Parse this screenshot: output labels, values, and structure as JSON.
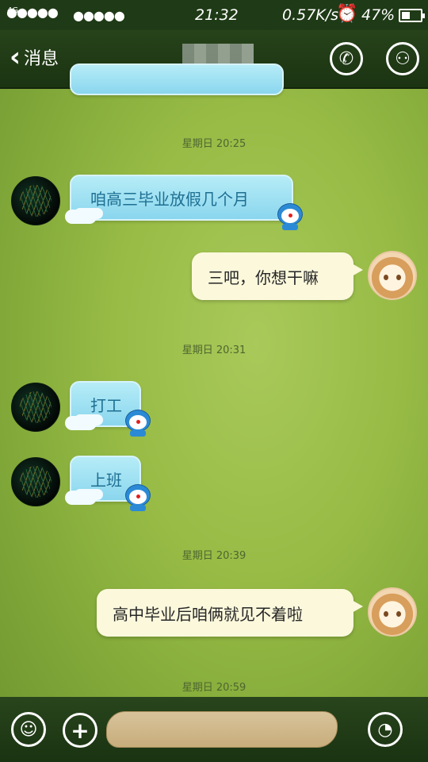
{
  "status_bar": {
    "network": "4G",
    "time": "21:32",
    "speed": "0.57K/s",
    "battery_text": "47%",
    "battery_level": 0.47
  },
  "header": {
    "back_label": "消息",
    "contact_name": ""
  },
  "messages": [
    {
      "type": "timestamp",
      "text": "星期日 20:25"
    },
    {
      "type": "received",
      "text": "咱高三毕业放假几个月"
    },
    {
      "type": "sent",
      "text": "三吧，你想干嘛"
    },
    {
      "type": "timestamp",
      "text": "星期日 20:31"
    },
    {
      "type": "received",
      "text": "打工"
    },
    {
      "type": "received",
      "text": "上班"
    },
    {
      "type": "timestamp",
      "text": "星期日 20:39"
    },
    {
      "type": "sent",
      "text": "高中毕业后咱俩就见不着啦"
    },
    {
      "type": "timestamp",
      "text": "星期日 20:59"
    }
  ],
  "input": {
    "value": "",
    "placeholder": ""
  },
  "colors": {
    "bar_bg": "#1f3a16",
    "bubble_blue": "#9fdff2",
    "bubble_me": "#fbf8dc",
    "text_blue": "#1e6f92"
  },
  "icons": [
    "phone-icon",
    "profile-icon",
    "emoji-icon",
    "plus-icon",
    "voice-icon",
    "alarm-icon",
    "battery-icon"
  ]
}
